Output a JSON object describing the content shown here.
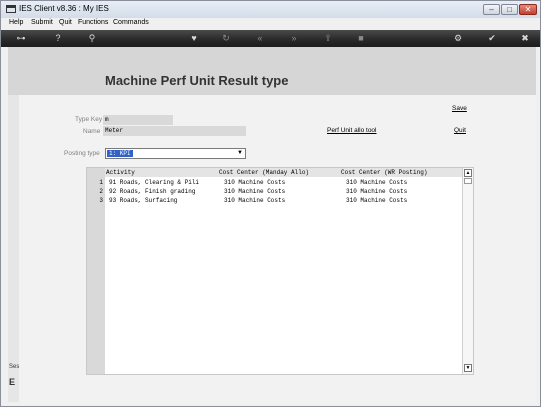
{
  "window": {
    "title": "IES Client v8.36 : My IES",
    "controls": {
      "minimize": "–",
      "restore": "□",
      "close": "✕"
    }
  },
  "menu": [
    "Help",
    "Submit",
    "Quit",
    "Functions",
    "Commands"
  ],
  "toolbar": {
    "icons": [
      "key-icon",
      "info-icon",
      "search-icon",
      "heart-icon",
      "refresh-icon",
      "rewind-icon",
      "fast-forward-icon",
      "export-icon",
      "stop-icon",
      "gear-icon",
      "check-icon",
      "close-icon"
    ],
    "glyphs": {
      "key": "⊶",
      "info": "?",
      "search": "⚲",
      "heart": "♥",
      "refresh": "↻",
      "rewind": "«",
      "forward": "»",
      "export": "⇪",
      "stop": "■",
      "gear": "⚙",
      "check": "✔",
      "close": "✖"
    }
  },
  "page": {
    "title": "Machine Perf Unit Result type",
    "save_link": "Save",
    "quit_link": "Quit",
    "tool_link": "Perf Unit allo tool"
  },
  "form": {
    "type_key_label": "Type Key",
    "type_key_value": "m",
    "name_label": "Name",
    "name_value": "Meter",
    "posting_type_label": "Posting type",
    "posting_type_value": "1: KPI"
  },
  "grid": {
    "columns": [
      "Activity",
      "Cost Center (Manday Allo)",
      "Cost Center (WR Posting)"
    ],
    "rows": [
      {
        "num": "1",
        "activity": "91 Roads, Clearing & Pili",
        "cc_manday": "310 Machine Costs",
        "cc_wr": "310 Machine Costs"
      },
      {
        "num": "2",
        "activity": "92 Roads, Finish grading",
        "cc_manday": "310 Machine Costs",
        "cc_wr": "310 Machine Costs"
      },
      {
        "num": "3",
        "activity": "93 Roads, Surfacing",
        "cc_manday": "310 Machine Costs",
        "cc_wr": "310 Machine Costs"
      }
    ]
  },
  "sidebar_fragments": {
    "top": "Ses",
    "bottom": "E"
  },
  "colors": {
    "toolbar_bg": "#2a2a2a",
    "select_highlight": "#3162c9",
    "field_bg": "#d9d9d9"
  }
}
